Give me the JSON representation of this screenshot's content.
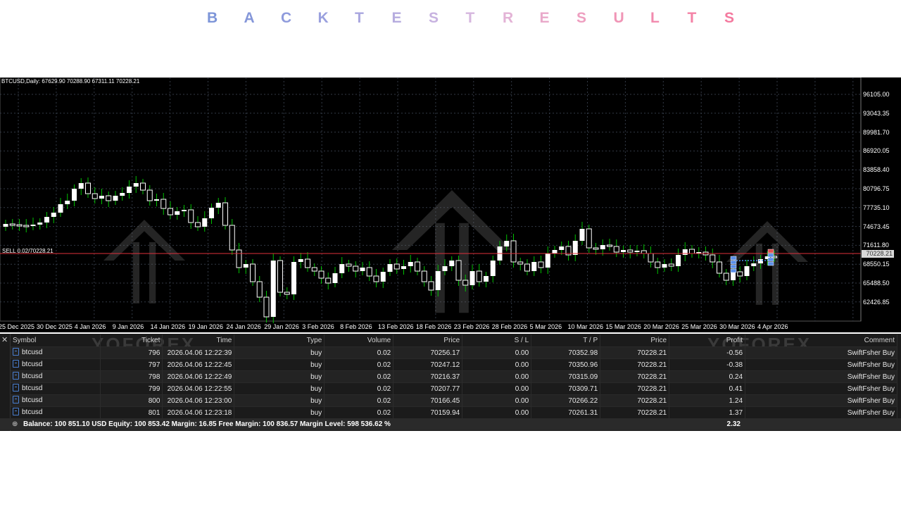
{
  "title": {
    "letters": [
      "B",
      "A",
      "C",
      "K",
      "T",
      "E",
      "S",
      "T",
      "R",
      "E",
      "S",
      "U",
      "L",
      "T",
      "S"
    ],
    "colors": [
      "#7d95d8",
      "#8597d9",
      "#8f9bdc",
      "#9aa0de",
      "#a9a6df",
      "#b6acdf",
      "#c7b2e0",
      "#d6b7df",
      "#e3b3d6",
      "#e9a9ca",
      "#ee9fc0",
      "#f095b6",
      "#f28bae",
      "#f482a6",
      "#f47a9f"
    ]
  },
  "chart": {
    "info": "BTCUSD,Daily: 67629.90 70288.90 67311.11 70228.21",
    "sell_label": "SELL 0.02/70228.21",
    "current_price": "70228.21",
    "price_labels": [
      "96105.00",
      "93043.35",
      "89981.70",
      "86920.05",
      "83858.40",
      "80796.75",
      "77735.10",
      "74673.45",
      "71611.80",
      "68550.15",
      "65488.50",
      "62426.85"
    ],
    "date_labels": [
      "25 Dec 2025",
      "30 Dec 2025",
      "4 Jan 2026",
      "9 Jan 2026",
      "14 Jan 2026",
      "19 Jan 2026",
      "24 Jan 2026",
      "29 Jan 2026",
      "3 Feb 2026",
      "8 Feb 2026",
      "13 Feb 2026",
      "18 Feb 2026",
      "23 Feb 2026",
      "28 Feb 2026",
      "5 Mar 2026",
      "10 Mar 2026",
      "15 Mar 2026",
      "20 Mar 2026",
      "25 Mar 2026",
      "30 Mar 2026",
      "4 Apr 2026"
    ],
    "colors": {
      "bull": "#ffffff",
      "bear": "#ffffff",
      "wick": "#00c000",
      "price_line": "#e0303a",
      "grid": "#333a46"
    }
  },
  "watermarks": [
    "YOFOREX",
    "YOFOREX"
  ],
  "table": {
    "columns": [
      "Symbol",
      "Ticket",
      "Time",
      "Type",
      "Volume",
      "Price",
      "S / L",
      "T / P",
      "Price",
      "Profit",
      "Comment"
    ],
    "rows": [
      [
        "btcusd",
        "796",
        "2026.04.06 12:22:39",
        "buy",
        "0.02",
        "70256.17",
        "0.00",
        "70352.98",
        "70228.21",
        "-0.56",
        "SwiftFsher Buy"
      ],
      [
        "btcusd",
        "797",
        "2026.04.06 12:22:45",
        "buy",
        "0.02",
        "70247.12",
        "0.00",
        "70350.96",
        "70228.21",
        "-0.38",
        "SwiftFsher Buy"
      ],
      [
        "btcusd",
        "798",
        "2026.04.06 12:22:49",
        "buy",
        "0.02",
        "70216.37",
        "0.00",
        "70315.09",
        "70228.21",
        "0.24",
        "SwiftFsher Buy"
      ],
      [
        "btcusd",
        "799",
        "2026.04.06 12:22:55",
        "buy",
        "0.02",
        "70207.77",
        "0.00",
        "70309.71",
        "70228.21",
        "0.41",
        "SwiftFsher Buy"
      ],
      [
        "btcusd",
        "800",
        "2026.04.06 12:23:00",
        "buy",
        "0.02",
        "70166.45",
        "0.00",
        "70266.22",
        "70228.21",
        "1.24",
        "SwiftFsher Buy"
      ],
      [
        "btcusd",
        "801",
        "2026.04.06 12:23:18",
        "buy",
        "0.02",
        "70159.94",
        "0.00",
        "70261.31",
        "70228.21",
        "1.37",
        "SwiftFsher Buy"
      ]
    ],
    "balance_text": "Balance: 100 851.10 USD  Equity: 100 853.42  Margin: 16.85  Free Margin: 100 836.57  Margin Level: 598 536.62 %",
    "total_profit": "2.32"
  }
}
